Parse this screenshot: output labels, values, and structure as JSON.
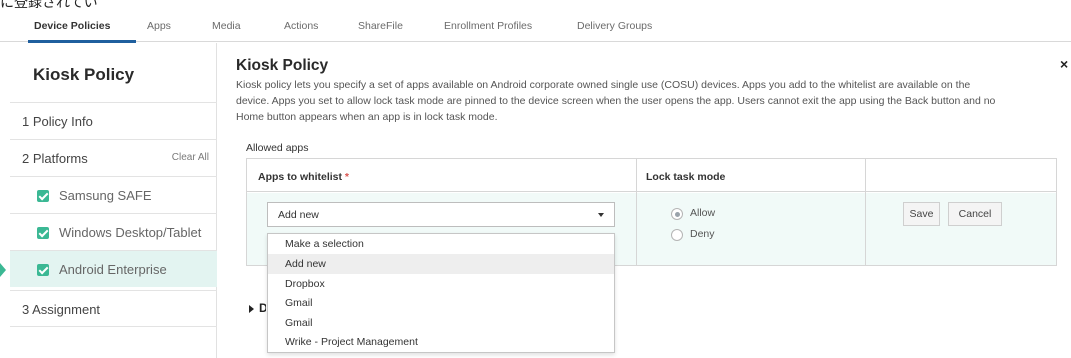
{
  "caption": "に登録されています。",
  "tabs": [
    {
      "label": "Device Policies"
    },
    {
      "label": "Apps"
    },
    {
      "label": "Media"
    },
    {
      "label": "Actions"
    },
    {
      "label": "ShareFile"
    },
    {
      "label": "Enrollment Profiles"
    },
    {
      "label": "Delivery Groups"
    }
  ],
  "sidebar": {
    "title": "Kiosk Policy",
    "steps": {
      "policy_info": "1  Policy Info",
      "platforms": "2  Platforms",
      "clear_all": "Clear All",
      "assignment": "3  Assignment"
    },
    "platforms": [
      {
        "label": "Samsung SAFE"
      },
      {
        "label": "Windows Desktop/Tablet"
      },
      {
        "label": "Android Enterprise"
      }
    ]
  },
  "main": {
    "title": "Kiosk Policy",
    "description": "Kiosk policy lets you specify a set of apps available on Android corporate owned single use (COSU) devices. Apps you add to the whitelist are available on the device. Apps you set to allow lock task mode are pinned to the device screen when the user opens the app. Users cannot exit the app using the Back button and no Home button appears when an app is in lock task mode.",
    "allowed_apps_label": "Allowed apps",
    "col_apps": "Apps to whitelist",
    "required_mark": "*",
    "col_lock": "Lock task mode",
    "select_value": "Add new",
    "dropdown_options": [
      {
        "label": "Make a selection"
      },
      {
        "label": "Add new"
      },
      {
        "label": "Dropbox"
      },
      {
        "label": "Gmail"
      },
      {
        "label": "Gmail"
      },
      {
        "label": "Wrike - Project Management"
      }
    ],
    "radio_allow": "Allow",
    "radio_deny": "Deny",
    "save_label": "Save",
    "cancel_label": "Cancel",
    "peek_text": "D"
  },
  "colors": {
    "accent": "#1f5f9e",
    "check_green": "#3bb894",
    "selected_bg": "#e3f4f1",
    "row_bg": "#f1faf8"
  }
}
